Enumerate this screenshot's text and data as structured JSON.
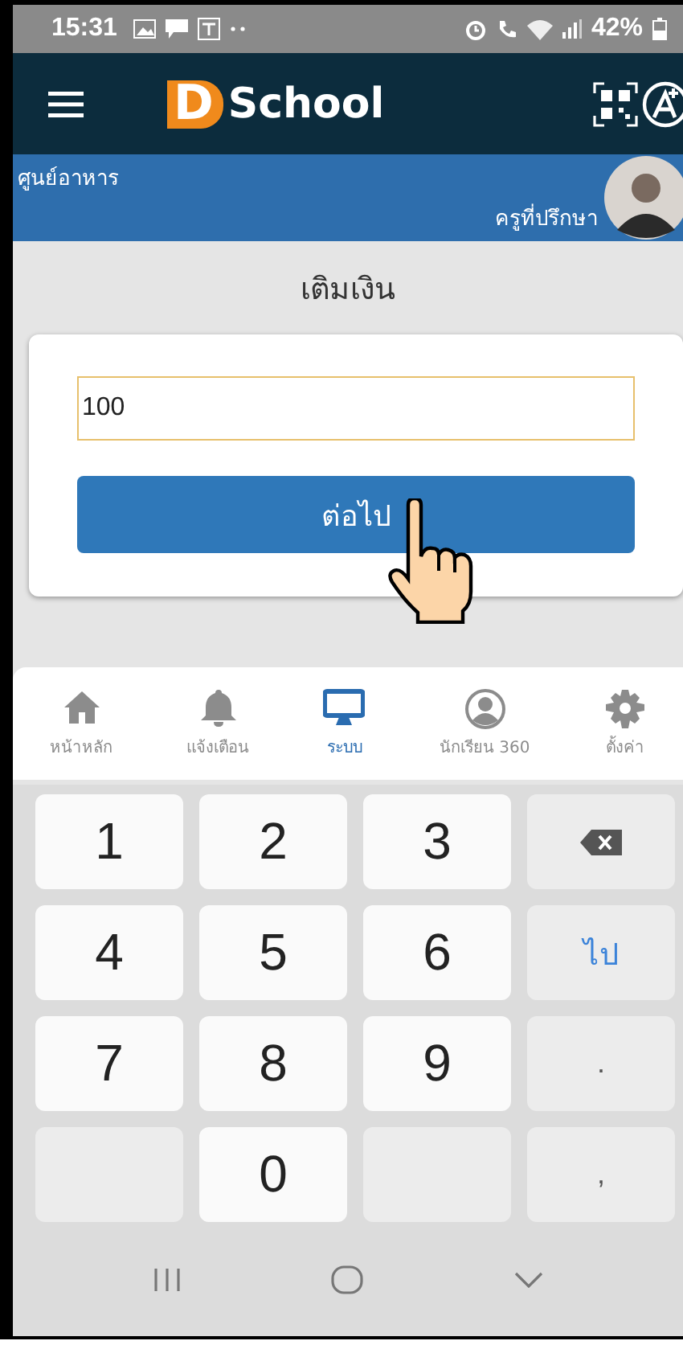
{
  "status_bar": {
    "time": "15:31",
    "battery": "42%"
  },
  "app_bar": {
    "logo_letter": "D",
    "logo_word": "School"
  },
  "header": {
    "place": "ศูนย์อาหาร",
    "role": "ครูที่ปรึกษา"
  },
  "page_title": "เติมเงิน",
  "form": {
    "amount": {
      "value": "100"
    },
    "button": "ต่อไป"
  },
  "bottom_nav": [
    {
      "label": "หน้าหลัก",
      "selected": false
    },
    {
      "label": "แจ้งเตือน",
      "selected": false
    },
    {
      "label": "ระบบ",
      "selected": true
    },
    {
      "label": "นักเรียน 360",
      "selected": false
    },
    {
      "label": "ตั้งค่า",
      "selected": false
    }
  ],
  "keypad": [
    {
      "kind": "digit",
      "label": "1"
    },
    {
      "kind": "digit",
      "label": "2"
    },
    {
      "kind": "digit",
      "label": "3"
    },
    {
      "kind": "backspace"
    },
    {
      "kind": "digit",
      "label": "4"
    },
    {
      "kind": "digit",
      "label": "5"
    },
    {
      "kind": "digit",
      "label": "6"
    },
    {
      "kind": "go",
      "label": "ไป"
    },
    {
      "kind": "digit",
      "label": "7"
    },
    {
      "kind": "digit",
      "label": "8"
    },
    {
      "kind": "digit",
      "label": "9"
    },
    {
      "kind": "symbol",
      "label": "."
    },
    {
      "kind": "blank"
    },
    {
      "kind": "digit",
      "label": "0"
    },
    {
      "kind": "blank"
    },
    {
      "kind": "symbol",
      "label": ","
    }
  ]
}
